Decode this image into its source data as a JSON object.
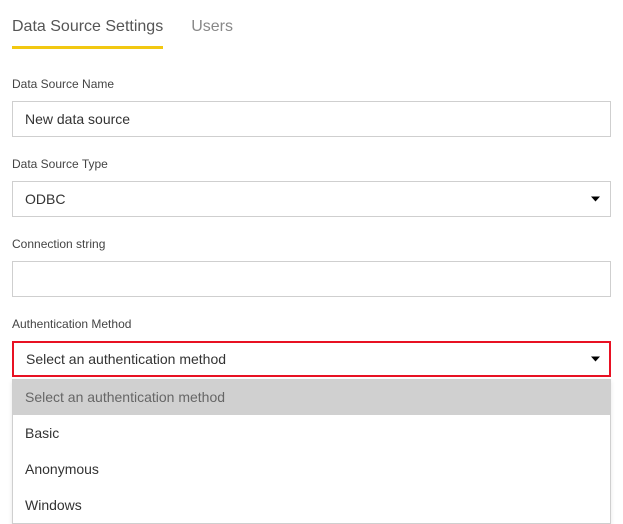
{
  "tabs": {
    "settings": "Data Source Settings",
    "users": "Users"
  },
  "fields": {
    "name_label": "Data Source Name",
    "name_value": "New data source",
    "type_label": "Data Source Type",
    "type_value": "ODBC",
    "conn_label": "Connection string",
    "conn_value": "",
    "auth_label": "Authentication Method",
    "auth_value": "Select an authentication method"
  },
  "auth_options": {
    "placeholder": "Select an authentication method",
    "basic": "Basic",
    "anonymous": "Anonymous",
    "windows": "Windows"
  }
}
